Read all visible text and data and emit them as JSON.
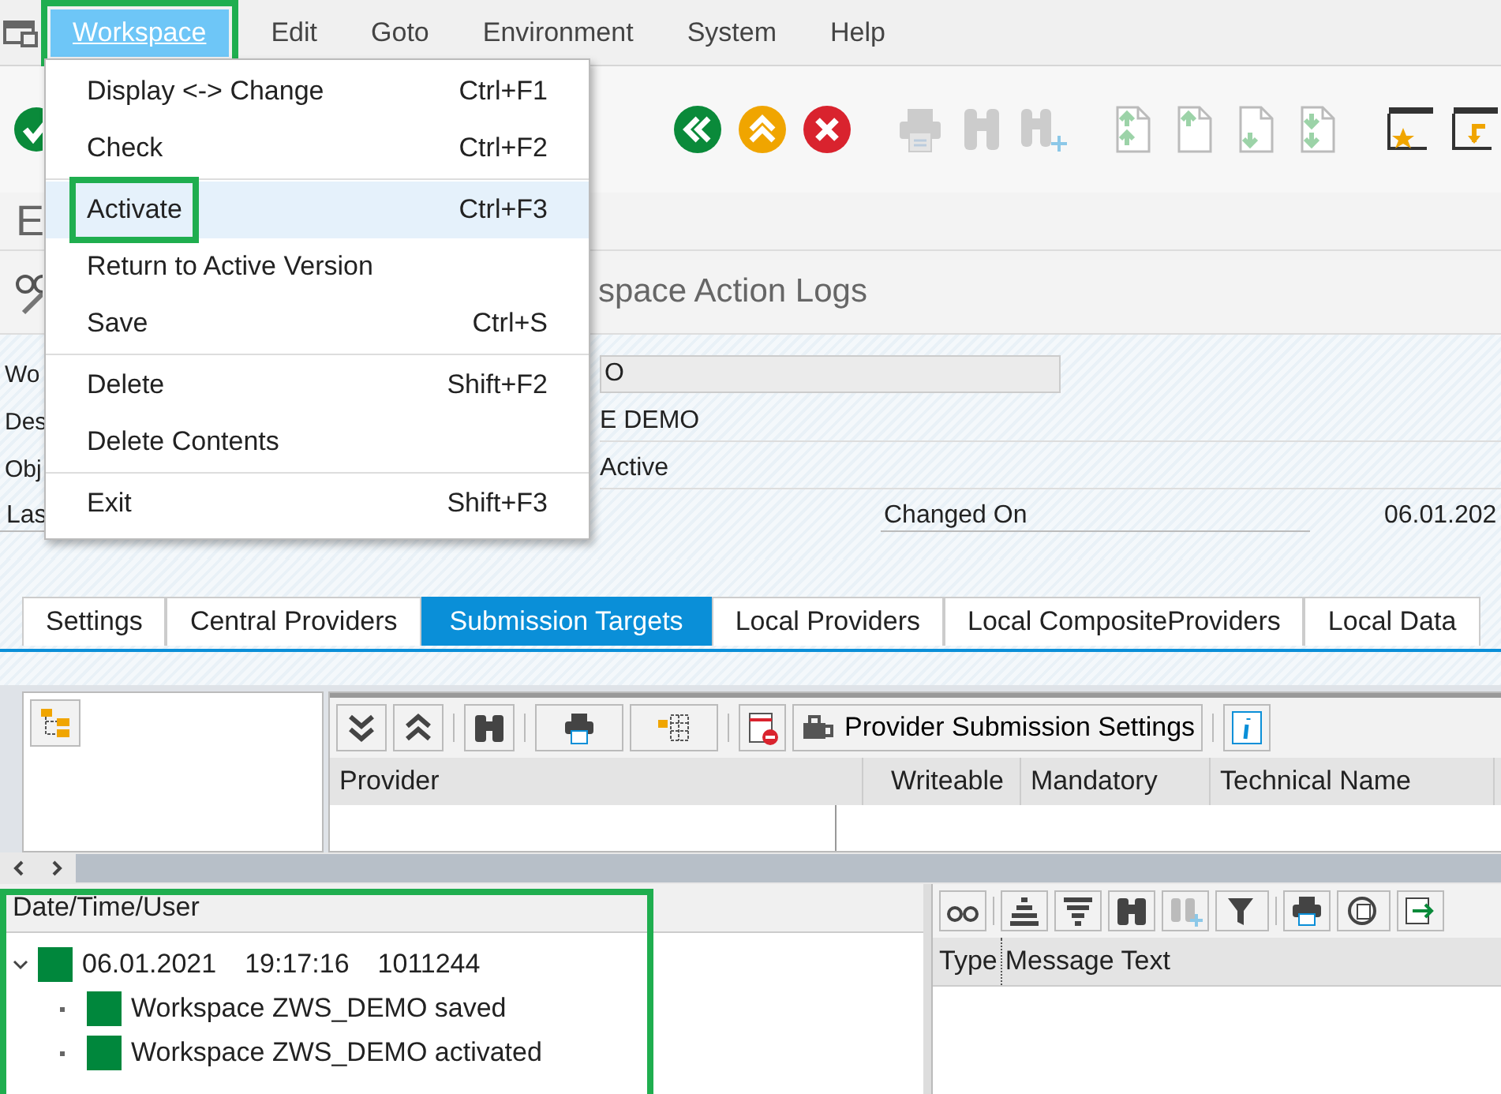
{
  "menubar": {
    "items": [
      {
        "label": "Workspace",
        "selected": true,
        "highlighted": true
      },
      {
        "label": "Edit",
        "selected": false,
        "highlighted": false
      },
      {
        "label": "Goto",
        "selected": false,
        "highlighted": false
      },
      {
        "label": "Environment",
        "selected": false,
        "highlighted": false
      },
      {
        "label": "System",
        "selected": false,
        "highlighted": false
      },
      {
        "label": "Help",
        "selected": false,
        "highlighted": false
      }
    ]
  },
  "menu": {
    "items": [
      {
        "label": "Display <-> Change",
        "shortcut": "Ctrl+F1",
        "selected": false,
        "highlighted": false,
        "separator_after": false
      },
      {
        "label": "Check",
        "shortcut": "Ctrl+F2",
        "selected": false,
        "highlighted": false,
        "separator_after": true
      },
      {
        "label": "Activate",
        "shortcut": "Ctrl+F3",
        "selected": true,
        "highlighted": true,
        "separator_after": false
      },
      {
        "label": "Return to Active Version",
        "selected": false,
        "highlighted": false,
        "separator_after": false
      },
      {
        "label": "Save",
        "shortcut": "Ctrl+S",
        "selected": false,
        "highlighted": false,
        "separator_after": true
      },
      {
        "label": "Delete",
        "shortcut": "Shift+F2",
        "selected": false,
        "highlighted": false,
        "separator_after": false
      },
      {
        "label": "Delete Contents",
        "selected": false,
        "highlighted": false,
        "separator_after": true
      },
      {
        "label": "Exit",
        "shortcut": "Shift+F3",
        "selected": false,
        "highlighted": false,
        "separator_after": false
      }
    ]
  },
  "title": "E",
  "subtitle": "space Action Logs",
  "form": {
    "rows": [
      {
        "kind": "field",
        "label": "Wo",
        "value": "O"
      },
      {
        "kind": "text",
        "label": "Des",
        "value": "E DEMO"
      },
      {
        "kind": "text",
        "label": "Obj",
        "value": "Active"
      },
      {
        "kind": "pair",
        "label": "Las",
        "label_2": "Changed On",
        "value_2": "06.01.202"
      }
    ]
  },
  "tabs": [
    {
      "label": "Settings",
      "selected": false
    },
    {
      "label": "Central Providers",
      "selected": false
    },
    {
      "label": "Submission Targets",
      "selected": true
    },
    {
      "label": "Local Providers",
      "selected": false
    },
    {
      "label": "Local CompositeProviders",
      "selected": false
    },
    {
      "label": "Local Data",
      "selected": false
    }
  ],
  "grid": {
    "button": "Provider Submission Settings",
    "columns": [
      "Provider",
      "Writeable",
      "Mandatory",
      "Technical Name"
    ]
  },
  "log": {
    "header": "Date/Time/User",
    "highlighted": true,
    "nodes": [
      {
        "date": "06.01.2021",
        "time": "19:17:16",
        "user": "1011244",
        "expanded": true,
        "children": [
          {
            "text": "Workspace ZWS_DEMO saved"
          },
          {
            "text": "Workspace ZWS_DEMO activated"
          }
        ]
      }
    ]
  },
  "messages": {
    "columns": [
      "Type",
      "Message Text"
    ]
  }
}
